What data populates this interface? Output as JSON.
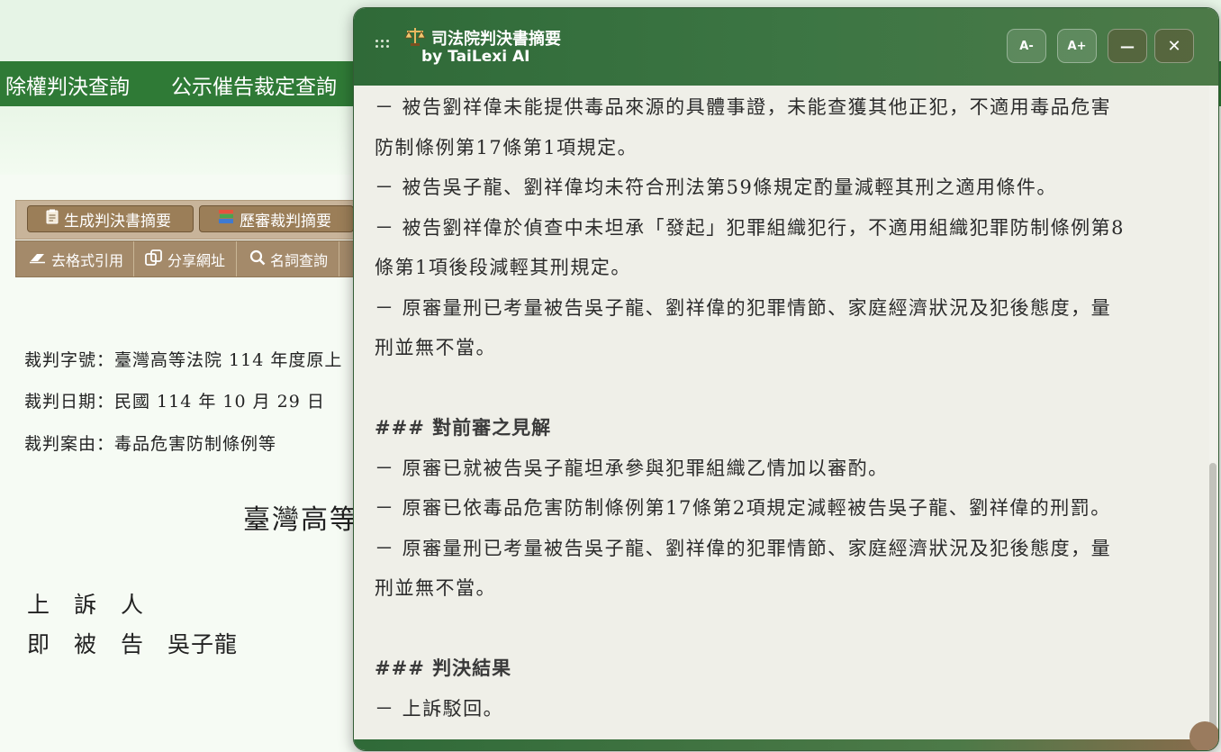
{
  "nav": {
    "items": [
      "除權判決查詢",
      "公示催告裁定查詢"
    ]
  },
  "toolbar": {
    "primary": [
      {
        "label": "生成判決書摘要",
        "icon": "clipboard-icon"
      },
      {
        "label": "歷審裁判摘要",
        "icon": "books-icon"
      }
    ],
    "secondary": [
      {
        "label": "去格式引用",
        "icon": "eraser-icon"
      },
      {
        "label": "分享網址",
        "icon": "copy-link-icon"
      },
      {
        "label": "名詞查詢",
        "icon": "search-icon"
      }
    ]
  },
  "case": {
    "number": "裁判字號：臺灣高等法院 114 年度原上",
    "date": "裁判日期：民國 114 年 10 月 29 日",
    "reason": "裁判案由：毒品危害防制條例等",
    "court_title": "臺灣高等",
    "party_role_1": "上　訴　人",
    "party_role_2": "即　被　告",
    "party_name": "吳子龍"
  },
  "panel": {
    "title": "司法院判決書摘要",
    "subtitle": "by TaiLexi AI",
    "buttons": {
      "font_down": "A-",
      "font_up": "A+",
      "minimize": "—",
      "close": "✕"
    },
    "lines": [
      "－ 被告劉祥偉未能提供毒品來源的具體事證，未能查獲其他正犯，不適用毒品危害",
      "防制條例第17條第1項規定。",
      "－ 被告吳子龍、劉祥偉均未符合刑法第59條規定酌量減輕其刑之適用條件。",
      "－ 被告劉祥偉於偵查中未坦承「發起」犯罪組織犯行，不適用組織犯罪防制條例第8",
      "條第1項後段減輕其刑規定。",
      "－ 原審量刑已考量被告吳子龍、劉祥偉的犯罪情節、家庭經濟狀況及犯後態度，量",
      "刑並無不當。",
      "### 對前審之見解",
      "－ 原審已就被告吳子龍坦承參與犯罪組織乙情加以審酌。",
      "－ 原審已依毒品危害防制條例第17條第2項規定減輕被告吳子龍、劉祥偉的刑罰。",
      "－ 原審量刑已考量被告吳子龍、劉祥偉的犯罪情節、家庭經濟狀況及犯後態度，量",
      "刑並無不當。",
      "### 判決結果",
      "－ 上訴駁回。"
    ]
  },
  "colors": {
    "nav_green": "#2f7a36",
    "panel_header": "#3d7644",
    "button_brown": "#9b7e58"
  }
}
